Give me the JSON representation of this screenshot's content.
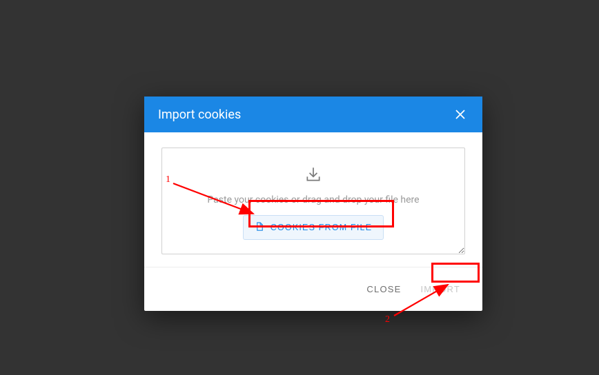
{
  "dialog": {
    "title": "Import cookies",
    "hint": "Paste your cookies or drag and drop your file here",
    "file_button": "COOKIES FROM FILE",
    "close_label": "CLOSE",
    "import_label": "IMPORT"
  },
  "annotations": {
    "label1": "1",
    "label2": "2"
  }
}
